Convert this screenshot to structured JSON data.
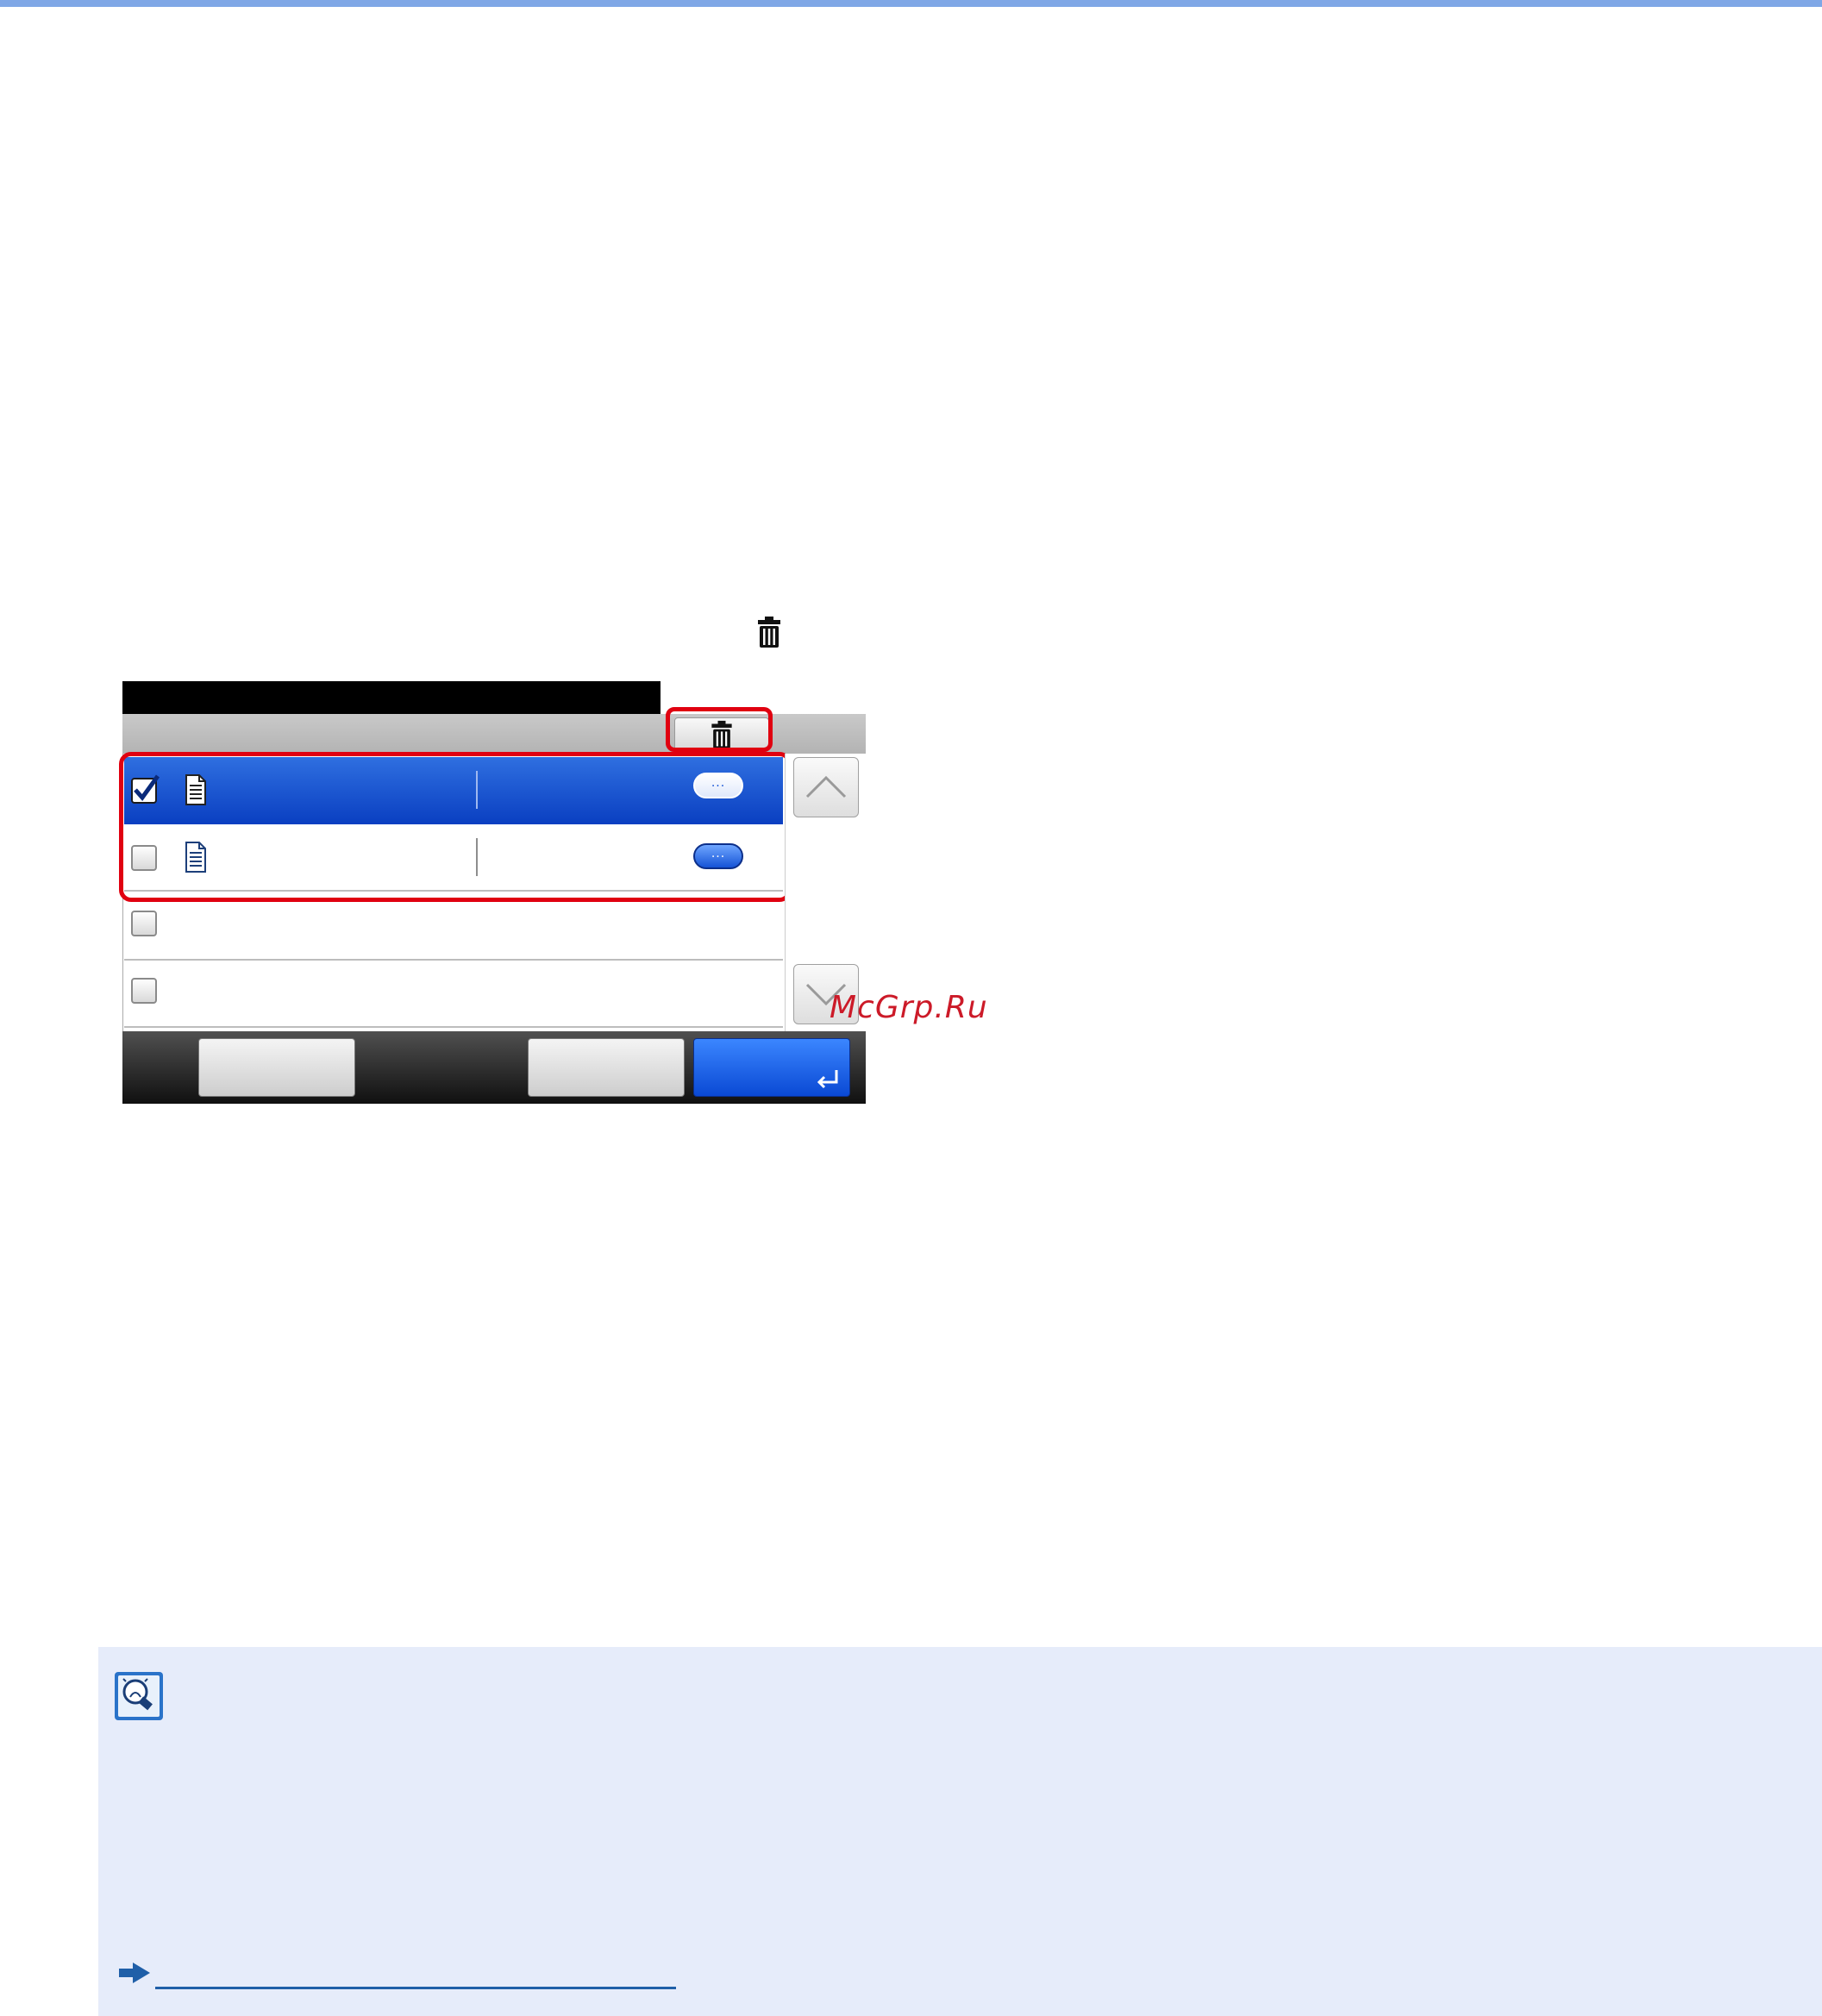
{
  "watermark": "McGrp.Ru",
  "icons": {
    "inline_trash": "trash-icon",
    "toolbar_trash": "trash-icon",
    "document": "document-icon",
    "more": "more-dots-icon",
    "scroll_up": "chevron-up-icon",
    "scroll_down": "chevron-down-icon",
    "enter": "enter-icon",
    "note": "lightbulb-note-icon",
    "reference": "arrow-right-icon"
  },
  "colors": {
    "highlight": "#e00010",
    "selected_row": "#0a3fc1",
    "note_background": "#e6ecfa",
    "top_rule": "#7fa7e6",
    "watermark": "#cc1a28"
  },
  "list": {
    "rows": [
      {
        "checked": true,
        "has_document": true,
        "selected": true
      },
      {
        "checked": false,
        "has_document": true,
        "selected": false
      },
      {
        "checked": false,
        "has_document": false,
        "selected": false
      },
      {
        "checked": false,
        "has_document": false,
        "selected": false
      }
    ]
  }
}
